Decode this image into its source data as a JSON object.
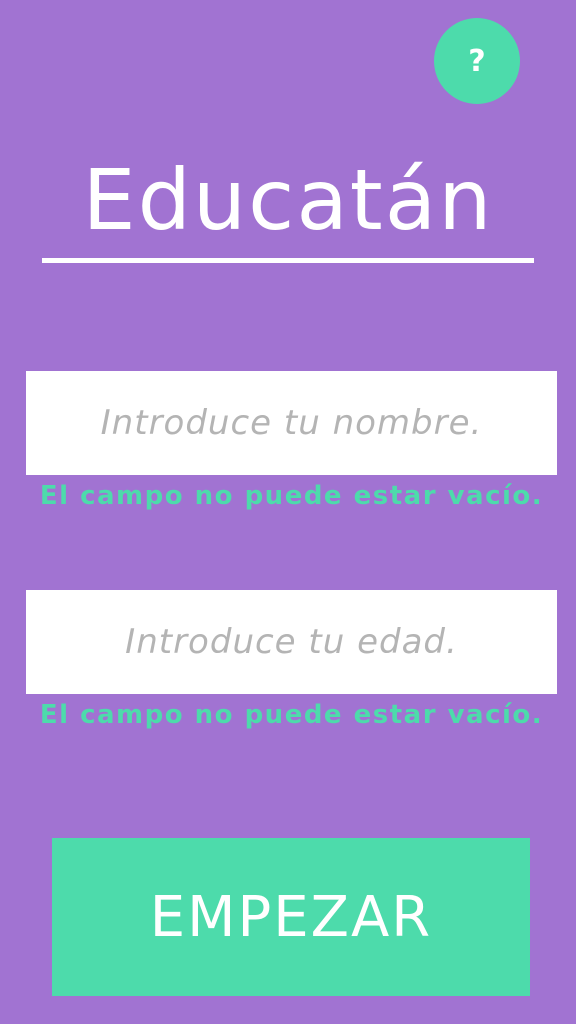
{
  "help_button": {
    "label": "?"
  },
  "app_title": "Educatán",
  "name_field": {
    "value": "",
    "placeholder": "Introduce tu nombre.",
    "error": "El campo no puede estar vacío."
  },
  "age_field": {
    "value": "",
    "placeholder": "Introduce tu edad.",
    "error": "El campo no puede estar vacío."
  },
  "start_button": {
    "label": "EMPEZAR"
  },
  "colors": {
    "background": "#a173d2",
    "accent": "#4ddbab",
    "text_light": "#ffffff",
    "placeholder": "#b4b4b4"
  }
}
